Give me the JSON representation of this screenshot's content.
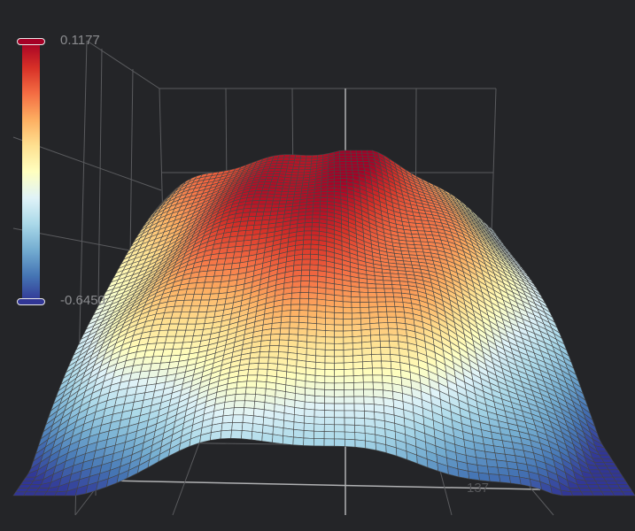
{
  "chart_data": {
    "type": "surface3d",
    "visual_map": {
      "max_label": "0.1177",
      "min_label": "-0.6450",
      "range": [
        -0.645,
        0.1177
      ],
      "colors": [
        "#313695",
        "#4575b4",
        "#74add1",
        "#abd9e9",
        "#e0f3f8",
        "#ffffbf",
        "#fee090",
        "#fdae61",
        "#f46d43",
        "#d73027",
        "#a50026"
      ]
    },
    "axis_tick_labels": [
      "137"
    ],
    "grid": true,
    "mesh_line_color": "#454545",
    "background": "#242528"
  }
}
